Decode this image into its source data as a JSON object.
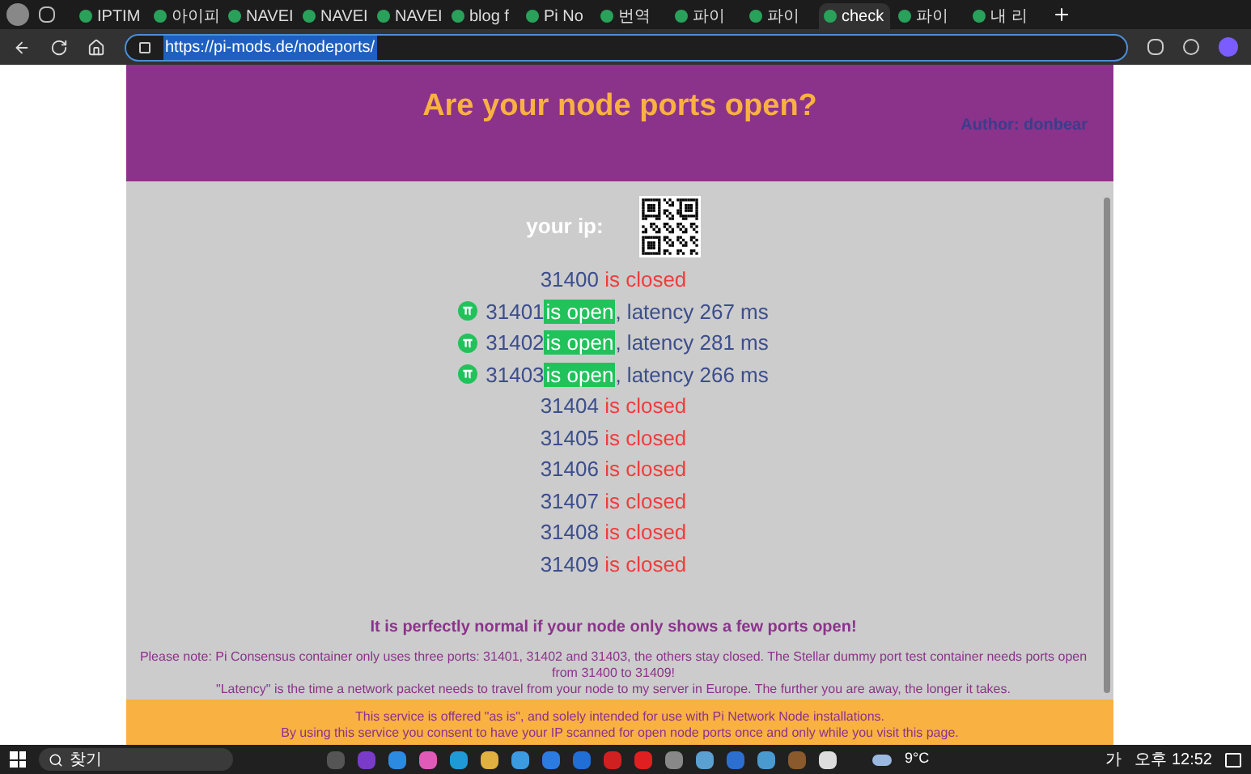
{
  "browser": {
    "tabs": [
      {
        "label": "IPTIM",
        "selected": false
      },
      {
        "label": "아이피",
        "selected": false
      },
      {
        "label": "NAVEI",
        "selected": false
      },
      {
        "label": "NAVEI",
        "selected": false
      },
      {
        "label": "NAVEI",
        "selected": false
      },
      {
        "label": "blog f",
        "selected": false
      },
      {
        "label": "Pi No",
        "selected": false
      },
      {
        "label": "번역",
        "selected": false
      },
      {
        "label": "파이",
        "selected": false
      },
      {
        "label": "파이",
        "selected": false
      },
      {
        "label": "check",
        "selected": true
      },
      {
        "label": "파이",
        "selected": false
      },
      {
        "label": "내 리",
        "selected": false
      }
    ],
    "address": "https://pi-mods.de/nodeports/"
  },
  "page": {
    "title": "Are your node ports open?",
    "author": "Author: donbear",
    "ip_label": "your ip:",
    "ports": [
      {
        "port": "31400",
        "status": "is closed",
        "open": false
      },
      {
        "port": "31401",
        "status": "is open",
        "open": true,
        "latency": ", latency 267 ms"
      },
      {
        "port": "31402",
        "status": "is open",
        "open": true,
        "latency": ", latency 281 ms"
      },
      {
        "port": "31403",
        "status": "is open",
        "open": true,
        "latency": ", latency 266 ms"
      },
      {
        "port": "31404",
        "status": "is closed",
        "open": false
      },
      {
        "port": "31405",
        "status": "is closed",
        "open": false
      },
      {
        "port": "31406",
        "status": "is closed",
        "open": false
      },
      {
        "port": "31407",
        "status": "is closed",
        "open": false
      },
      {
        "port": "31408",
        "status": "is closed",
        "open": false
      },
      {
        "port": "31409",
        "status": "is closed",
        "open": false
      }
    ],
    "notice": "It is perfectly normal if your node only shows a few ports open!",
    "note": "Please note: Pi Consensus container only uses three ports: 31401, 31402 and 31403, the others stay closed. The Stellar dummy port test container needs ports open from 31400 to 31409!",
    "latency_note": "\"Latency\" is the time a network packet needs to travel from your node to my server in Europe. The further you are away, the longer it takes.",
    "footer": [
      "This service is offered \"as is\", and solely intended for use with Pi Network Node installations.",
      "By using this service you consent to have your IP scanned for open node ports once and only while you visit this page."
    ]
  },
  "taskbar": {
    "search": "찾기",
    "weather": "9°C",
    "ime": "가",
    "time": "오후 12:52"
  }
}
